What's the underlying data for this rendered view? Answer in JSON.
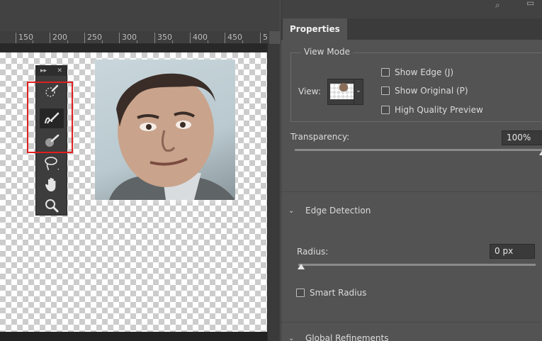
{
  "ruler": {
    "labels": [
      "150",
      "200",
      "250",
      "300",
      "350",
      "400",
      "450",
      "5"
    ]
  },
  "tool_panel": {
    "tools": [
      {
        "icon": "quick-selection-icon",
        "active": false
      },
      {
        "icon": "refine-edge-brush-icon",
        "active": true
      },
      {
        "icon": "brush-icon",
        "active": false
      },
      {
        "icon": "lasso-icon",
        "active": false
      },
      {
        "icon": "hand-icon",
        "active": false
      },
      {
        "icon": "zoom-icon",
        "active": false
      }
    ],
    "highlight_color": "#e01e1e"
  },
  "properties": {
    "tab_label": "Properties",
    "view_mode": {
      "title": "View Mode",
      "view_label": "View:",
      "show_edge": "Show Edge (J)",
      "show_original": "Show Original (P)",
      "high_quality_preview": "High Quality Preview"
    },
    "transparency": {
      "label": "Transparency:",
      "value": "100%",
      "level": 1.0
    },
    "edge_detection": {
      "title": "Edge Detection",
      "radius_label": "Radius:",
      "radius_value": "0 px",
      "radius_level": 0.0,
      "smart_radius": "Smart Radius"
    },
    "global_refinements": {
      "title": "Global Refinements"
    }
  }
}
